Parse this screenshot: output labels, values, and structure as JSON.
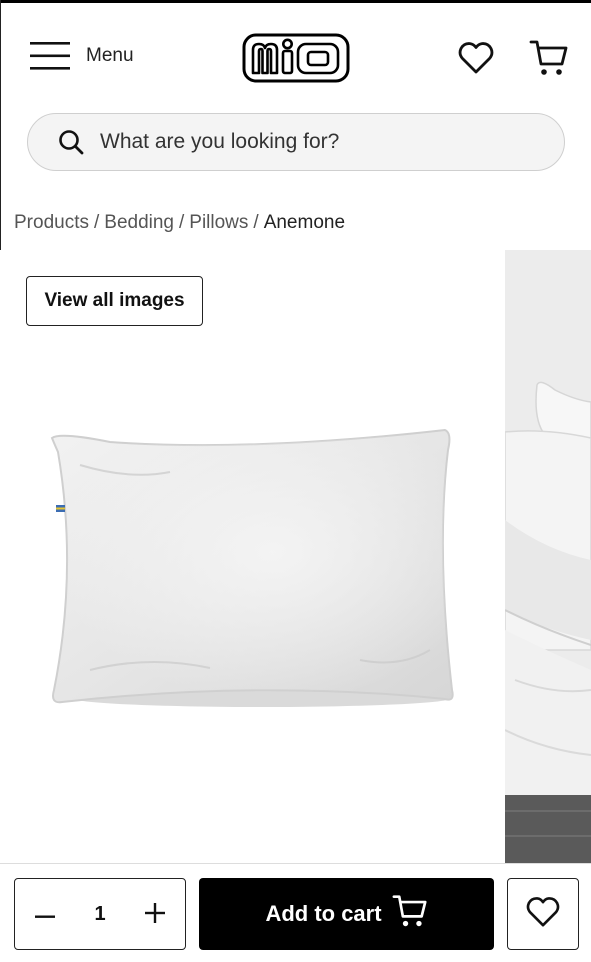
{
  "header": {
    "menu_label": "Menu",
    "logo_text": "mio",
    "icons": [
      "hamburger-icon",
      "heart-icon",
      "cart-icon"
    ]
  },
  "search": {
    "placeholder": "What are you looking for?",
    "value": "",
    "icon": "search-icon"
  },
  "breadcrumb": {
    "items": [
      "Products",
      "Bedding",
      "Pillows"
    ],
    "current": "Anemone",
    "separator": "/"
  },
  "gallery": {
    "view_all_label": "View all images"
  },
  "bottom_bar": {
    "quantity": "1",
    "add_to_cart_label": "Add to cart",
    "minus_icon": "minus-icon",
    "plus_icon": "plus-icon"
  },
  "colors": {
    "primary": "#000000",
    "search_bg": "#f4f4f4",
    "text_muted": "#555555"
  }
}
